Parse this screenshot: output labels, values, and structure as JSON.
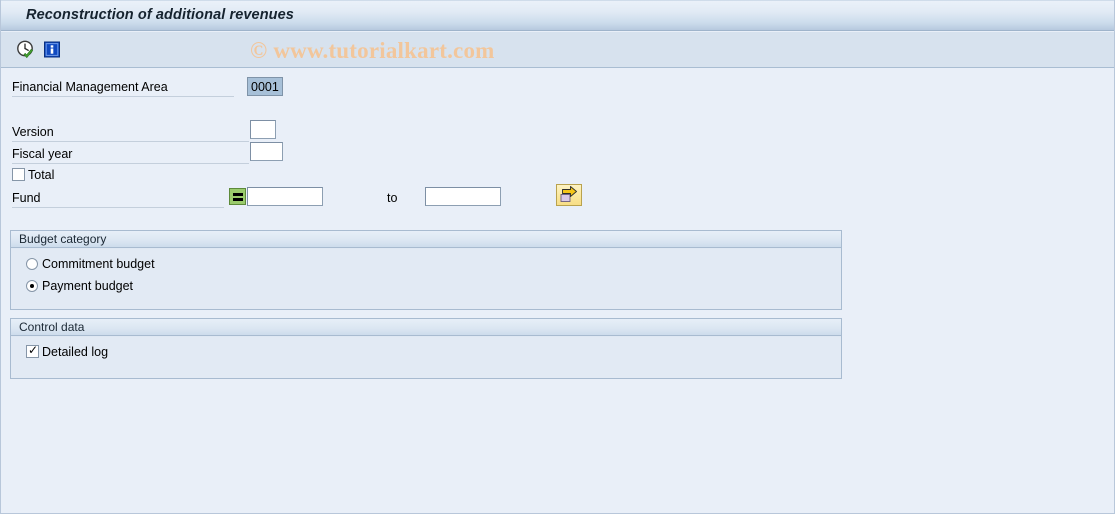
{
  "window": {
    "title": "Reconstruction of additional revenues"
  },
  "toolbar": {
    "buttons": [
      {
        "name": "execute-icon",
        "tooltip": "Execute"
      },
      {
        "name": "information-icon",
        "tooltip": "Information"
      }
    ]
  },
  "watermark": {
    "text": "© www.tutorialkart.com"
  },
  "selection_screen": {
    "fields": [
      {
        "label": "Financial Management Area",
        "value": "0001",
        "state": "selected"
      },
      {
        "label": "Version",
        "value": "",
        "state": "empty"
      },
      {
        "label": "Fiscal year",
        "value": "",
        "state": "empty"
      }
    ],
    "total_checkbox": {
      "label": "Total",
      "checked": false
    },
    "fund": {
      "label": "Fund",
      "operator": "=",
      "from_value": "",
      "to_label": "to",
      "to_value": "",
      "multiple_selection_tooltip": "Multiple selection"
    }
  },
  "budget_category": {
    "title": "Budget category",
    "options": [
      {
        "label": "Commitment budget",
        "selected": false
      },
      {
        "label": "Payment budget",
        "selected": true
      }
    ]
  },
  "control_data": {
    "title": "Control data",
    "options": [
      {
        "label": "Detailed log",
        "checked": true
      }
    ]
  },
  "colors": {
    "window_bg": "#e9eff8",
    "titlebar_from": "#eaf1f9",
    "titlebar_to": "#b6c9de",
    "toolbar_bg": "#d7e2ee",
    "group_bg": "#e2eaf4",
    "field_selected_bg": "#a7c0d8",
    "operator_green": "#9acb6c",
    "button_yellow": "#fbe9a0",
    "watermark": "#f2c69b"
  }
}
